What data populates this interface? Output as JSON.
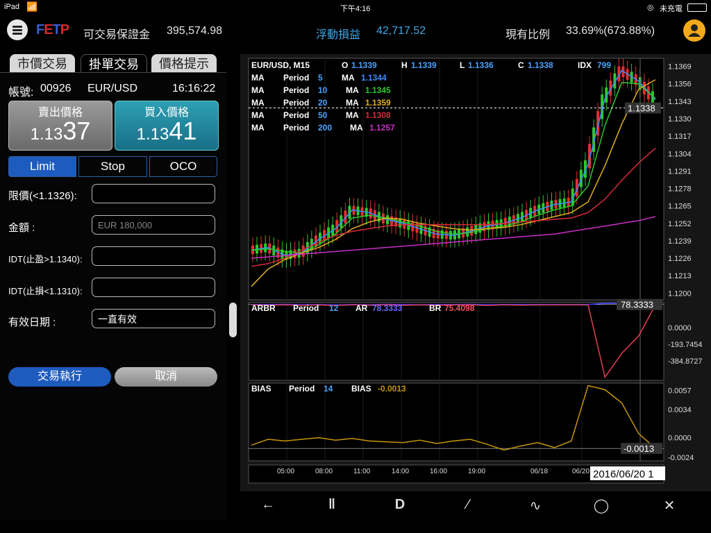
{
  "status_bar": {
    "device": "iPad",
    "time": "下午4:16",
    "battery": "未充電"
  },
  "header": {
    "logo": "FETP",
    "margin_label": "可交易保證金",
    "margin_value": "395,574.98",
    "pl_label": "浮動損益",
    "pl_value": "42,717.52",
    "ratio_label": "現有比例",
    "ratio_value": "33.69%(673.88%)"
  },
  "tabs": [
    "市價交易",
    "掛單交易",
    "價格提示"
  ],
  "order": {
    "account_label": "帳號:",
    "account": "00926",
    "symbol": "EUR/USD",
    "time": "16:16:22",
    "sell_label": "賣出價格",
    "sell_price_prefix": "1.13",
    "sell_price_big": "37",
    "buy_label": "買入價格",
    "buy_price_prefix": "1.13",
    "buy_price_big": "41",
    "types": [
      "Limit",
      "Stop",
      "OCO"
    ],
    "limit_label": "限價(<1.1326):",
    "amount_label": "金額 :",
    "amount_placeholder": "EUR 180,000",
    "tp_label": "IDT(止盈>1.1340):",
    "sl_label": "IDT(止損<1.1310):",
    "expiry_label": "有效日期 :",
    "expiry_value": "一直有效",
    "execute_label": "交易執行",
    "cancel_label": "取消"
  },
  "chart_info": {
    "header": {
      "pair": "EUR/USD, M15",
      "o_label": "O",
      "o": "1.1339",
      "h_label": "H",
      "h": "1.1339",
      "l_label": "L",
      "l": "1.1336",
      "c_label": "C",
      "c": "1.1338",
      "idx_label": "IDX",
      "idx": "799"
    },
    "ma_lines": [
      {
        "ma": "MA",
        "period_label": "Period",
        "period": "5",
        "val_label": "MA",
        "value": "1.1344",
        "color": "#3b8cff"
      },
      {
        "ma": "MA",
        "period_label": "Period",
        "period": "10",
        "val_label": "MA",
        "value": "1.1345",
        "color": "#2ec82e"
      },
      {
        "ma": "MA",
        "period_label": "Period",
        "period": "20",
        "val_label": "MA",
        "value": "1.1359",
        "color": "#e0b020"
      },
      {
        "ma": "MA",
        "period_label": "Period",
        "period": "50",
        "val_label": "MA",
        "value": "1.1308",
        "color": "#d82b3a"
      },
      {
        "ma": "MA",
        "period_label": "Period",
        "period": "200",
        "val_label": "MA",
        "value": "1.1257",
        "color": "#c82ec8"
      }
    ],
    "price_ticks": [
      "1.1369",
      "1.1356",
      "1.1343",
      "1.1330",
      "1.1317",
      "1.1304",
      "1.1291",
      "1.1278",
      "1.1265",
      "1.1252",
      "1.1239",
      "1.1226",
      "1.1213",
      "1.1200"
    ],
    "current_price": "1.1338",
    "arbr": {
      "name": "ARBR",
      "period_label": "Period",
      "period": "12",
      "ar_label": "AR",
      "ar": "78.3333",
      "br_label": "BR",
      "br": "75.4098",
      "ticks": [
        "0.0000",
        "-193.7454",
        "-384.8727"
      ],
      "marker": "78.3333"
    },
    "bias": {
      "name": "BIAS",
      "period_label": "Period",
      "period": "14",
      "val_label": "BIAS",
      "value": "-0.0013",
      "ticks": [
        "0.0057",
        "0.0034",
        "0.0000",
        "-0.0024"
      ],
      "marker": "-0.0013"
    },
    "time_ticks": [
      "05:00",
      "08:00",
      "11:00",
      "14:00",
      "16:00",
      "19:00",
      "06/18",
      "06/20"
    ],
    "date_marker": "2016/06/20 1",
    "colors": {
      "up": "#2ec82e",
      "down": "#e03030",
      "ar": "#3b3bff",
      "br": "#e04050",
      "bias": "#c8960c"
    }
  },
  "chart_data": {
    "type": "line",
    "title": "EUR/USD, M15",
    "ylim": [
      1.1195,
      1.1375
    ],
    "series": [
      {
        "name": "MA 5",
        "values": [
          1.1232,
          1.1234,
          1.1228,
          1.123,
          1.124,
          1.1248,
          1.1262,
          1.126,
          1.1255,
          1.1252,
          1.1248,
          1.1244,
          1.1243,
          1.1246,
          1.125,
          1.1252,
          1.1256,
          1.1262,
          1.1266,
          1.1268,
          1.1296,
          1.1345,
          1.1366,
          1.1358,
          1.1344
        ]
      },
      {
        "name": "MA 10",
        "values": [
          1.1232,
          1.1233,
          1.1231,
          1.123,
          1.1236,
          1.1244,
          1.1256,
          1.1258,
          1.1256,
          1.1253,
          1.125,
          1.1246,
          1.1244,
          1.1245,
          1.1248,
          1.125,
          1.1253,
          1.1258,
          1.1262,
          1.1265,
          1.128,
          1.1325,
          1.1357,
          1.1356,
          1.1345
        ]
      },
      {
        "name": "MA 20",
        "values": [
          1.1205,
          1.1218,
          1.1225,
          1.123,
          1.1234,
          1.124,
          1.1248,
          1.1253,
          1.1256,
          1.1255,
          1.1252,
          1.125,
          1.1248,
          1.1247,
          1.1248,
          1.1249,
          1.1251,
          1.1254,
          1.1257,
          1.126,
          1.1268,
          1.1295,
          1.1326,
          1.1352,
          1.1359
        ]
      },
      {
        "name": "MA 50",
        "values": [
          1.122,
          1.1222,
          1.1226,
          1.1232,
          1.1238,
          1.1243,
          1.1246,
          1.1248,
          1.125,
          1.1251,
          1.1251,
          1.1251,
          1.1251,
          1.1251,
          1.1251,
          1.1252,
          1.1253,
          1.1254,
          1.1255,
          1.1256,
          1.126,
          1.127,
          1.1284,
          1.1297,
          1.1308
        ]
      },
      {
        "name": "MA 200",
        "values": [
          1.1226,
          1.1227,
          1.1228,
          1.1229,
          1.123,
          1.1231,
          1.1232,
          1.1233,
          1.1234,
          1.1235,
          1.1236,
          1.1237,
          1.1238,
          1.1239,
          1.124,
          1.1241,
          1.1242,
          1.1243,
          1.1244,
          1.1246,
          1.1248,
          1.125,
          1.1252,
          1.1254,
          1.1257
        ]
      }
    ],
    "arbr": {
      "ar": [
        78,
        78,
        79,
        77,
        78,
        76,
        78,
        77,
        79,
        78,
        77,
        78,
        78,
        79,
        77,
        78,
        78,
        78,
        78,
        78,
        78,
        85,
        85,
        85,
        78
      ],
      "br": [
        75,
        74,
        76,
        73,
        75,
        72,
        76,
        74,
        77,
        73,
        75,
        74,
        75,
        76,
        72,
        76,
        74,
        75,
        75,
        76,
        75,
        -380,
        -230,
        -120,
        75
      ]
    },
    "bias": [
      -0.0009,
      -0.0002,
      -0.0004,
      -0.0002,
      0.0,
      -0.0003,
      -0.0001,
      -0.0004,
      -0.0005,
      -0.0006,
      -0.0003,
      -0.0007,
      -0.0004,
      -0.0002,
      -0.0008,
      -0.0015,
      -0.001,
      -0.0006,
      -0.0012,
      -0.0004,
      0.0063,
      0.0058,
      0.0042,
      0.0005,
      -0.0013
    ]
  },
  "toolbar": [
    "arrow-tool-icon",
    "parallel-lines-icon",
    "d-tool-icon",
    "trend-line-icon",
    "curve-tool-icon",
    "ellipse-tool-icon",
    "delete-all-icon"
  ]
}
